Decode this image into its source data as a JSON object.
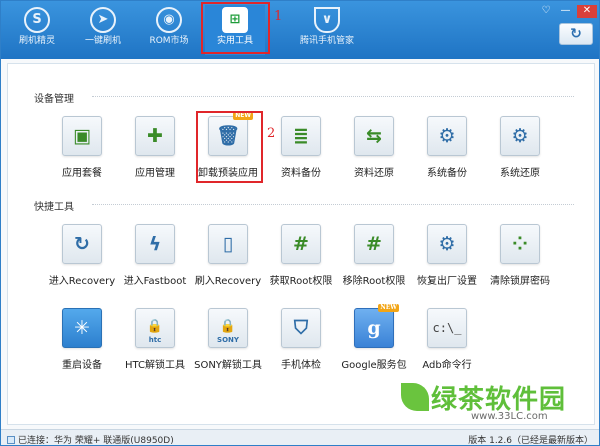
{
  "nav": {
    "items": [
      {
        "label": "刷机精灵",
        "icon": "brand-logo-icon",
        "glyph": "S"
      },
      {
        "label": "一键刷机",
        "icon": "cursor-icon",
        "glyph": "➤"
      },
      {
        "label": "ROM市场",
        "icon": "android-icon",
        "glyph": "◉"
      },
      {
        "label": "实用工具",
        "icon": "grid-icon",
        "glyph": "⊞",
        "active": true
      },
      {
        "label": "腾讯手机管家",
        "icon": "shield-icon",
        "glyph": "∨"
      }
    ]
  },
  "markers": {
    "one": "1",
    "two": "2"
  },
  "window_controls": {
    "feedback": "♡",
    "minimize": "—",
    "close": "✕"
  },
  "refresh_glyph": "↻",
  "sections": {
    "device_mgmt": {
      "title": "设备管理",
      "tools": [
        {
          "label": "应用套餐",
          "glyph": "▣",
          "icon": "app-bundle-icon"
        },
        {
          "label": "应用管理",
          "glyph": "✚",
          "icon": "puzzle-icon"
        },
        {
          "label": "卸载预装应用",
          "glyph": "🗑",
          "icon": "trash-icon",
          "badge": "NEW"
        },
        {
          "label": "资料备份",
          "glyph": "≣",
          "icon": "document-backup-icon"
        },
        {
          "label": "资料还原",
          "glyph": "⇆",
          "icon": "document-restore-icon"
        },
        {
          "label": "系统备份",
          "glyph": "⚙",
          "icon": "system-backup-icon"
        },
        {
          "label": "系统还原",
          "glyph": "⚙",
          "icon": "system-restore-icon"
        }
      ]
    },
    "quick_tools": {
      "title": "快捷工具",
      "tools": [
        {
          "label": "进入Recovery",
          "glyph": "↻",
          "icon": "recovery-icon"
        },
        {
          "label": "进入Fastboot",
          "glyph": "ϟ",
          "icon": "fastboot-icon"
        },
        {
          "label": "刷入Recovery",
          "glyph": "▯",
          "icon": "flash-recovery-icon"
        },
        {
          "label": "获取Root权限",
          "glyph": "#",
          "icon": "root-icon"
        },
        {
          "label": "移除Root权限",
          "glyph": "#",
          "icon": "unroot-icon"
        },
        {
          "label": "恢复出厂设置",
          "glyph": "⚙",
          "icon": "factory-reset-icon"
        },
        {
          "label": "清除锁屏密码",
          "glyph": "⁘",
          "icon": "pattern-lock-icon"
        },
        {
          "label": "重启设备",
          "glyph": "✳",
          "icon": "reboot-icon"
        },
        {
          "label": "HTC解锁工具",
          "glyph": "🔒",
          "icon": "htc-unlock-icon",
          "sub": "htc"
        },
        {
          "label": "SONY解锁工具",
          "glyph": "🔒",
          "icon": "sony-unlock-icon",
          "sub": "SONY"
        },
        {
          "label": "手机体检",
          "glyph": "⛉",
          "icon": "phone-checkup-icon"
        },
        {
          "label": "Google服务包",
          "glyph": "g",
          "icon": "google-icon",
          "badge": "NEW"
        },
        {
          "label": "Adb命令行",
          "glyph": "c:\\_",
          "icon": "terminal-icon"
        }
      ]
    }
  },
  "status": {
    "connection": "已连接：华为 荣耀+ 联通版(U8950D)",
    "version": "版本 1.2.6（已经是最新版本）"
  },
  "watermark": {
    "main": "绿茶软件园",
    "sub": "www.33LC.com"
  },
  "colors": {
    "header": "#2a86d8",
    "highlight": "#e0262a",
    "accent_green": "#1f9c3a"
  }
}
